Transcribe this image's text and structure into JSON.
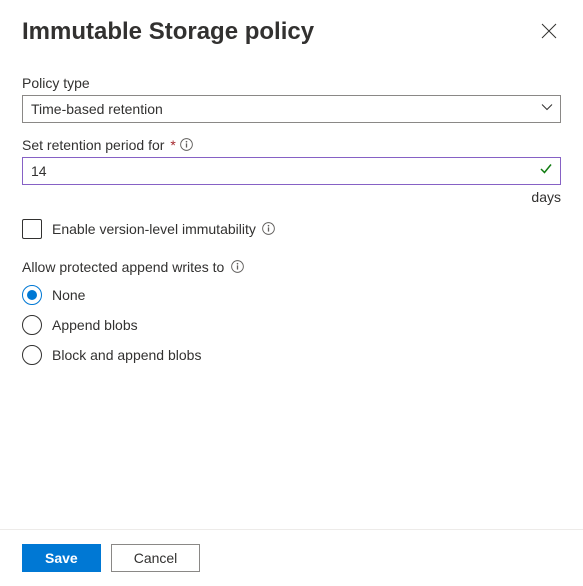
{
  "header": {
    "title": "Immutable Storage policy"
  },
  "policyType": {
    "label": "Policy type",
    "value": "Time-based retention"
  },
  "retention": {
    "label": "Set retention period for",
    "value": "14",
    "suffix": "days"
  },
  "versionLevel": {
    "label": "Enable version-level immutability",
    "checked": false
  },
  "appendWrites": {
    "label": "Allow protected append writes to",
    "options": [
      {
        "label": "None",
        "checked": true
      },
      {
        "label": "Append blobs",
        "checked": false
      },
      {
        "label": "Block and append blobs",
        "checked": false
      }
    ]
  },
  "footer": {
    "save": "Save",
    "cancel": "Cancel"
  }
}
